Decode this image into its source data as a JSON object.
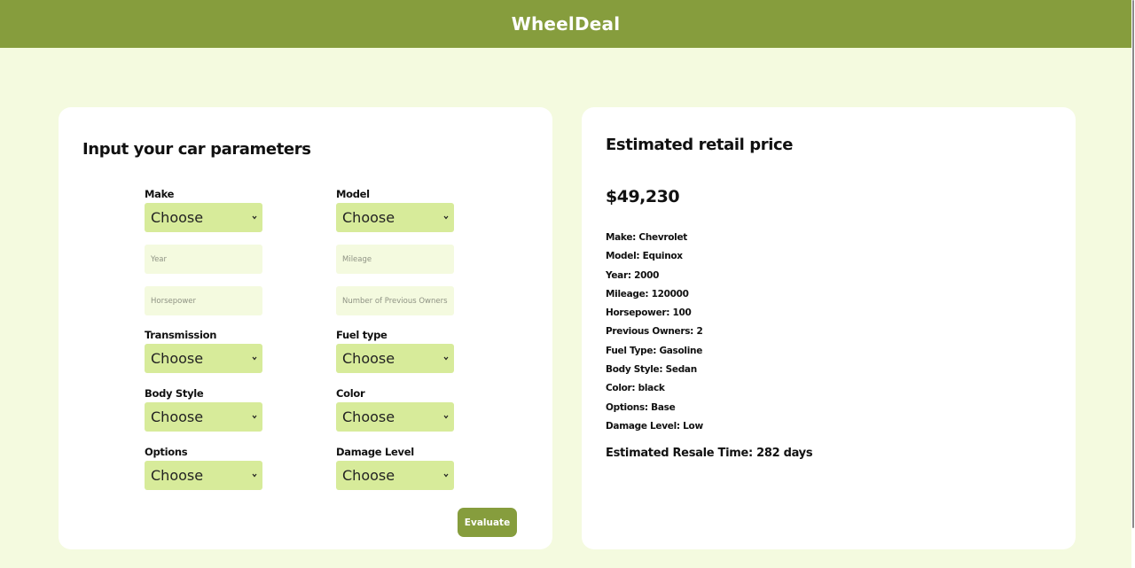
{
  "app": {
    "brand": "WheelDeal"
  },
  "form": {
    "title": "Input your car parameters",
    "make": {
      "label": "Make",
      "value": "Choose"
    },
    "model": {
      "label": "Model",
      "value": "Choose"
    },
    "year": {
      "placeholder": "Year"
    },
    "mileage": {
      "placeholder": "Mileage"
    },
    "horsepower": {
      "placeholder": "Horsepower"
    },
    "previous_owners": {
      "placeholder": "Number of Previous Owners"
    },
    "transmission": {
      "label": "Transmission",
      "value": "Choose"
    },
    "fuel_type": {
      "label": "Fuel type",
      "value": "Choose"
    },
    "body_style": {
      "label": "Body Style",
      "value": "Choose"
    },
    "color": {
      "label": "Color",
      "value": "Choose"
    },
    "options": {
      "label": "Options",
      "value": "Choose"
    },
    "damage_level": {
      "label": "Damage Level",
      "value": "Choose"
    },
    "evaluate_label": "Evaluate"
  },
  "result": {
    "title": "Estimated retail price",
    "price": "$49,230",
    "details": [
      "Make: Chevrolet",
      "Model: Equinox",
      "Year: 2000",
      "Mileage: 120000",
      "Horsepower: 100",
      "Previous Owners: 2",
      "Fuel Type: Gasoline",
      "Body Style: Sedan",
      "Color: black",
      "Options: Base",
      "Damage Level: Low"
    ],
    "resale_time": "Estimated Resale Time: 282 days"
  },
  "colors": {
    "header": "#869d3d",
    "page_background": "#f4fadf",
    "select_background": "#d7eb9a",
    "button": "#869d3d"
  },
  "icons": {
    "select_arrow": "chevron-down-icon"
  }
}
